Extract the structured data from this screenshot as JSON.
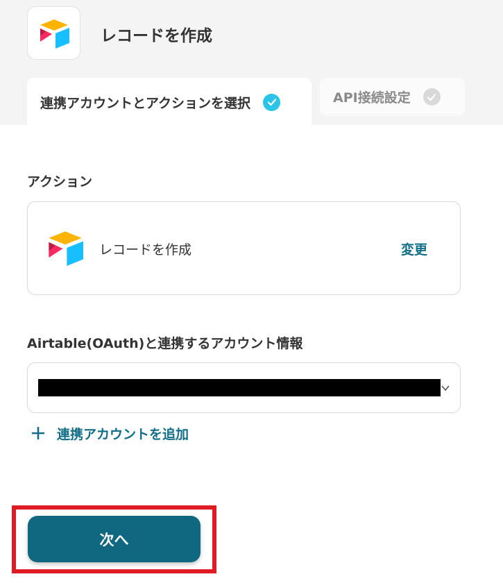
{
  "header": {
    "title": "レコードを作成",
    "app_icon": "airtable-logo-icon"
  },
  "tabs": [
    {
      "label": "連携アカウントとアクションを選択",
      "state": "completed",
      "active": true
    },
    {
      "label": "API接続設定",
      "state": "pending",
      "active": false
    }
  ],
  "action_section": {
    "label": "アクション",
    "card": {
      "icon": "airtable-logo-icon",
      "name": "レコードを作成",
      "change_label": "変更"
    }
  },
  "account_section": {
    "label": "Airtable(OAuth)と連携するアカウント情報",
    "selected_value_redacted": true,
    "add_account_label": "連携アカウントを追加"
  },
  "footer": {
    "next_label": "次へ"
  },
  "colors": {
    "accent": "#116e86",
    "primary_button": "#0f6880",
    "check_done": "#2cc4e6",
    "highlight": "#e01b24",
    "header_bg": "#f4f4f4"
  }
}
